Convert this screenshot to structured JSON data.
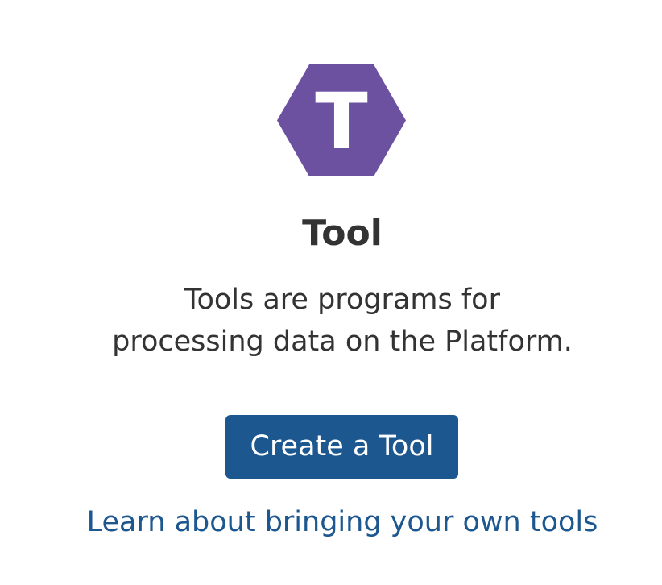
{
  "icon": {
    "name": "tool-hexagon-icon",
    "letter": "T",
    "color": "#6c51a1"
  },
  "title": "Tool",
  "description": {
    "line1": "Tools are programs for",
    "line2": "processing data on the Platform."
  },
  "primary_button": {
    "label": "Create a Tool",
    "color": "#1d578f"
  },
  "learn_link": {
    "label": "Learn about bringing your own tools",
    "color": "#1d578f"
  }
}
